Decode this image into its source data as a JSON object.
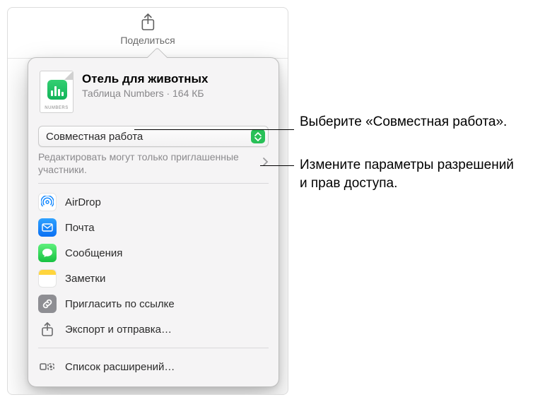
{
  "toolbar": {
    "share_button_label": "Поделиться"
  },
  "document": {
    "title": "Отель для животных",
    "subtitle": "Таблица Numbers · 164 КБ",
    "icon_caption": "NUMBERS"
  },
  "collaboration": {
    "mode_label": "Совместная работа",
    "permissions_text": "Редактировать могут только приглашенные участники."
  },
  "share_targets": [
    {
      "icon": "airdrop-icon",
      "label": "AirDrop"
    },
    {
      "icon": "mail-icon",
      "label": "Почта"
    },
    {
      "icon": "messages-icon",
      "label": "Сообщения"
    },
    {
      "icon": "notes-icon",
      "label": "Заметки"
    },
    {
      "icon": "link-icon",
      "label": "Пригласить по ссылке"
    },
    {
      "icon": "export-icon",
      "label": "Экспорт и отправка…"
    }
  ],
  "extensions_label": "Список расширений…",
  "callouts": {
    "select_collab": "Выберите «Совместная работа».",
    "change_perms": "Измените параметры разрешений\nи прав доступа."
  }
}
